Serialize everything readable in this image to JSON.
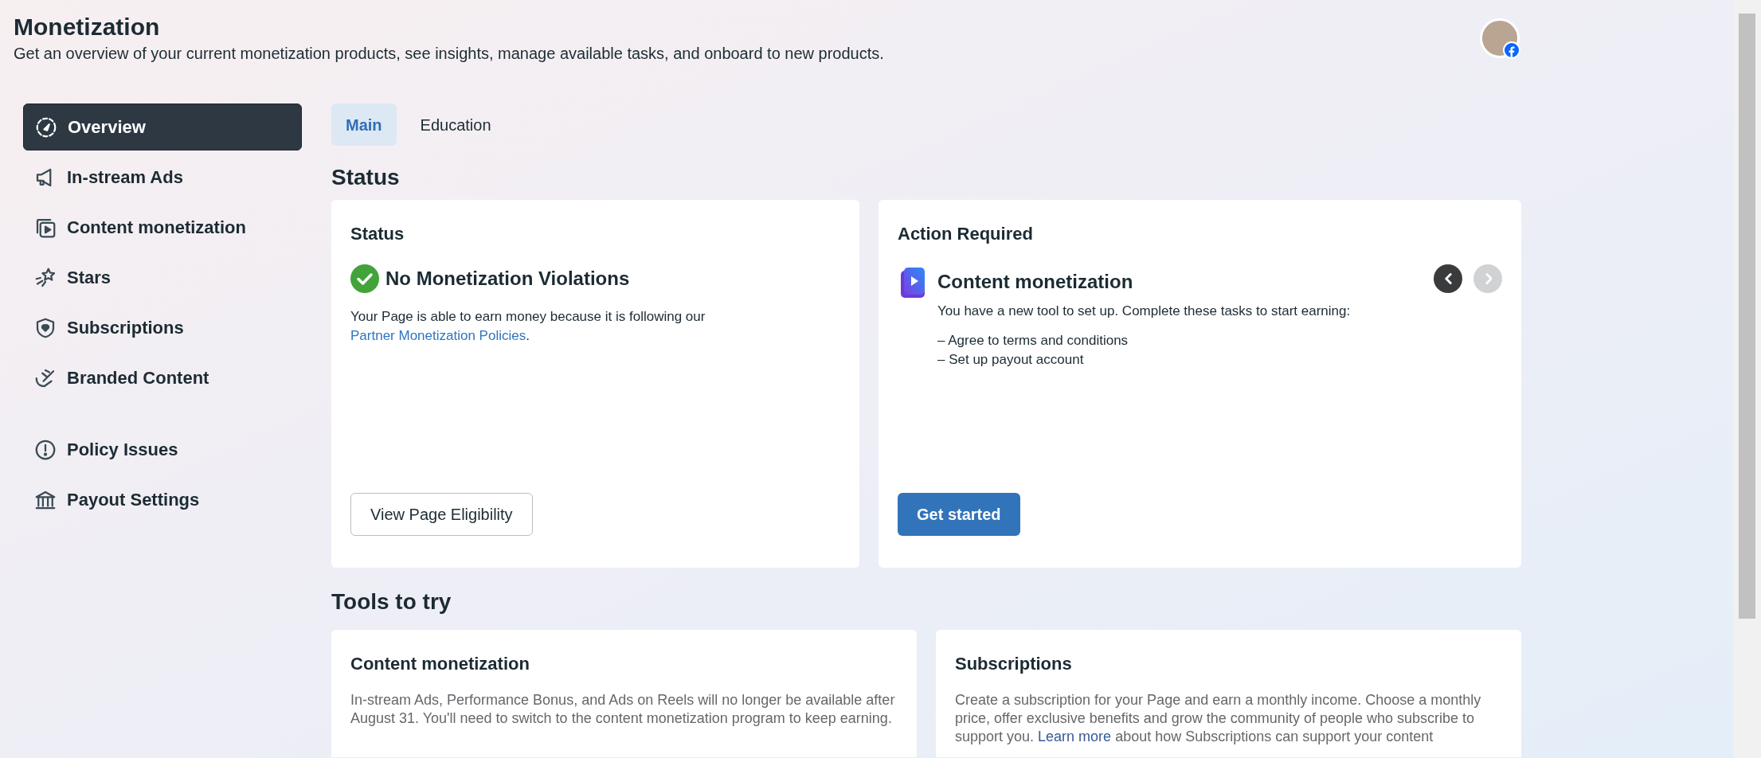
{
  "header": {
    "title": "Monetization",
    "subtitle": "Get an overview of your current monetization products, see insights, manage available tasks, and onboard to new products."
  },
  "sidebar": {
    "groups": [
      [
        {
          "label": "Overview",
          "selected": true
        },
        {
          "label": "In-stream Ads",
          "selected": false
        },
        {
          "label": "Content monetization",
          "selected": false
        },
        {
          "label": "Stars",
          "selected": false
        },
        {
          "label": "Subscriptions",
          "selected": false
        },
        {
          "label": "Branded Content",
          "selected": false
        }
      ],
      [
        {
          "label": "Policy Issues",
          "selected": false
        },
        {
          "label": "Payout Settings",
          "selected": false
        }
      ]
    ]
  },
  "tabs": [
    {
      "label": "Main",
      "selected": true
    },
    {
      "label": "Education",
      "selected": false
    }
  ],
  "status_section": {
    "heading": "Status",
    "status_card": {
      "title": "Status",
      "headline": "No Monetization Violations",
      "body": [
        {
          "kind": "text",
          "text": "Your Page is able to earn money because it is following our "
        },
        {
          "kind": "link",
          "text": "Partner Monetization Policies"
        },
        {
          "kind": "text",
          "text": "."
        }
      ],
      "button": "View Page Eligibility"
    },
    "action_card": {
      "title": "Action Required",
      "item_title": "Content monetization",
      "text": "You have a new tool to set up. Complete these tasks to start earning:",
      "tasks": [
        "– Agree to terms and conditions",
        "– Set up payout account"
      ],
      "prev": {
        "disabled": false
      },
      "next": {
        "disabled": true
      },
      "button": "Get started"
    }
  },
  "tools_section": {
    "heading": "Tools to try",
    "cards": [
      {
        "title": "Content monetization",
        "body": [
          {
            "kind": "text",
            "text": "In-stream Ads, Performance Bonus, and Ads on Reels will no longer be available after August 31. You'll need to switch to the content monetization program to keep earning."
          }
        ]
      },
      {
        "title": "Subscriptions",
        "body": [
          {
            "kind": "text",
            "text": "Create a subscription for your Page and earn a monthly income. Choose a monthly price, offer exclusive benefits and grow the community of people who subscribe to support you. "
          },
          {
            "kind": "link",
            "text": "Learn more"
          },
          {
            "kind": "text",
            "text": " about how Subscriptions can support your content"
          }
        ]
      }
    ]
  }
}
